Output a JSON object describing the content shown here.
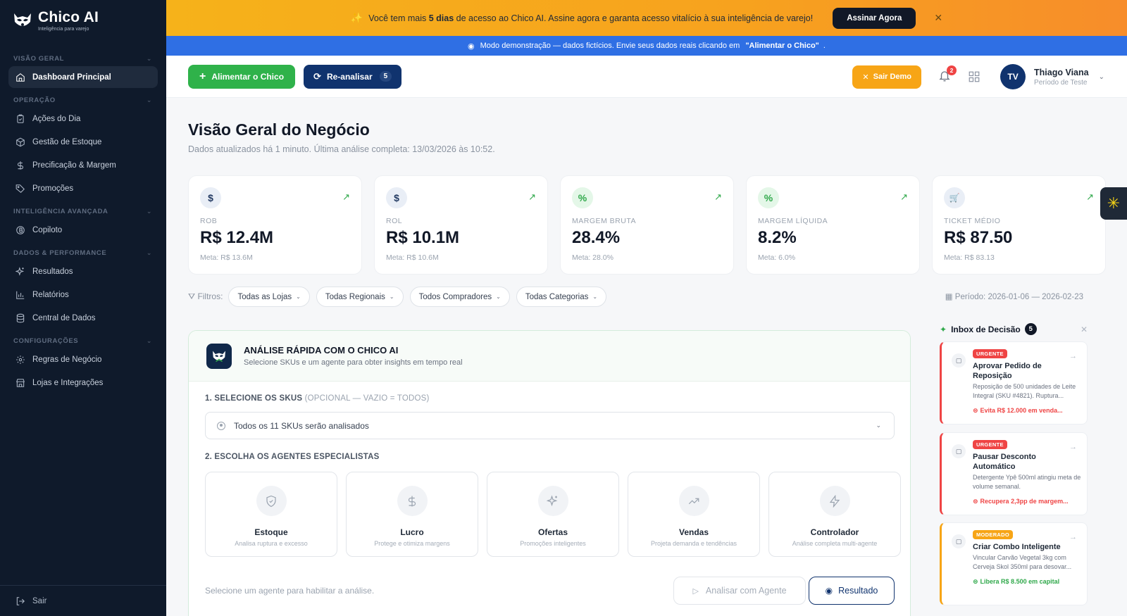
{
  "brand": {
    "name": "Chico AI",
    "tagline": "Inteligência para varejo"
  },
  "sidebar": {
    "sections": [
      {
        "title": "VISÃO GERAL",
        "items": [
          {
            "label": "Dashboard Principal",
            "icon": "home-icon",
            "active": true
          }
        ]
      },
      {
        "title": "OPERAÇÃO",
        "items": [
          {
            "label": "Ações do Dia",
            "icon": "clipboard-icon"
          },
          {
            "label": "Gestão de Estoque",
            "icon": "box-icon"
          },
          {
            "label": "Precificação & Margem",
            "icon": "dollar-icon"
          },
          {
            "label": "Promoções",
            "icon": "tag-icon"
          }
        ]
      },
      {
        "title": "INTELIGÊNCIA AVANÇADA",
        "items": [
          {
            "label": "Copiloto",
            "icon": "bitcoin-icon"
          }
        ]
      },
      {
        "title": "DADOS & PERFORMANCE",
        "items": [
          {
            "label": "Resultados",
            "icon": "sparkles-icon"
          },
          {
            "label": "Relatórios",
            "icon": "bar-chart-icon"
          },
          {
            "label": "Central de Dados",
            "icon": "database-icon"
          }
        ]
      },
      {
        "title": "CONFIGURAÇÕES",
        "items": [
          {
            "label": "Regras de Negócio",
            "icon": "gear-icon"
          },
          {
            "label": "Lojas e Integrações",
            "icon": "store-icon"
          }
        ]
      }
    ],
    "logout": "Sair"
  },
  "promo": {
    "text_before": "Você tem mais ",
    "text_bold": "5 dias",
    "text_after": " de acesso ao Chico AI. Assine agora e garanta acesso vitalício à sua inteligência de varejo!",
    "cta": "Assinar Agora"
  },
  "demo_banner": {
    "text": "Modo demonstração — dados fictícios. Envie seus dados reais clicando em",
    "highlight": "\"Alimentar o Chico\"",
    "suffix": "."
  },
  "toolbar": {
    "feed_label": "Alimentar o Chico",
    "reanalyze_label": "Re-analisar",
    "reanalyze_count": "5",
    "exit_demo": "Sair Demo",
    "notifications": "2",
    "user": {
      "initials": "TV",
      "name": "Thiago Viana",
      "role": "Período de Teste"
    }
  },
  "page": {
    "title": "Visão Geral do Negócio",
    "subtitle": "Dados atualizados há 1 minuto. Última análise completa: 13/03/2026 às 10:52."
  },
  "kpis": [
    {
      "icon_glyph": "$",
      "icon": "dollar-icon",
      "label": "ROB",
      "value": "R$ 12.4M",
      "meta": "Meta: R$ 13.6M"
    },
    {
      "icon_glyph": "$",
      "icon": "dollar-icon",
      "label": "ROL",
      "value": "R$ 10.1M",
      "meta": "Meta: R$ 10.6M"
    },
    {
      "icon_glyph": "%",
      "icon": "percent-icon",
      "label": "MARGEM BRUTA",
      "value": "28.4%",
      "meta": "Meta: 28.0%"
    },
    {
      "icon_glyph": "%",
      "icon": "percent-icon",
      "label": "MARGEM LÍQUIDA",
      "value": "8.2%",
      "meta": "Meta: 6.0%"
    },
    {
      "icon_glyph": "🛒",
      "icon": "cart-icon",
      "label": "TICKET MÉDIO",
      "value": "R$ 87.50",
      "meta": "Meta: R$ 83.13"
    }
  ],
  "filters": {
    "label": "Filtros:",
    "chips": [
      "Todas as Lojas",
      "Todas Regionais",
      "Todos Compradores",
      "Todas Categorias"
    ],
    "period": "Período: 2026-01-06 — 2026-02-23"
  },
  "analysis": {
    "title": "ANÁLISE RÁPIDA COM O CHICO AI",
    "subtitle": "Selecione SKUs e um agente para obter insights em tempo real",
    "step1": "1. SELECIONE OS SKUS",
    "step1_hint": " (OPCIONAL — VAZIO = TODOS)",
    "sku_value": "Todos os 11 SKUs serão analisados",
    "step2": "2. ESCOLHA OS AGENTES ESPECIALISTAS",
    "agents": [
      {
        "name": "Estoque",
        "desc": "Analisa ruptura e excesso",
        "icon": "shield-icon"
      },
      {
        "name": "Lucro",
        "desc": "Protege e otimiza margens",
        "icon": "dollar-icon"
      },
      {
        "name": "Ofertas",
        "desc": "Promoções inteligentes",
        "icon": "sparkles-icon"
      },
      {
        "name": "Vendas",
        "desc": "Projeta demanda e tendências",
        "icon": "trend-icon"
      },
      {
        "name": "Controlador",
        "desc": "Análise completa multi-agente",
        "icon": "bolt-icon"
      }
    ],
    "footer_hint": "Selecione um agente para habilitar a análise.",
    "analyze_btn": "Analisar com Agente",
    "result_btn": "Resultado"
  },
  "inbox": {
    "title": "Inbox de Decisão",
    "count": "5",
    "cards": [
      {
        "tag": "URGENTE",
        "title": "Aprovar Pedido de Reposição",
        "desc": "Reposição de 500 unidades de Leite Integral (SKU #4821). Ruptura...",
        "impact": "Evita R$ 12.000 em venda...",
        "tone": "urgent"
      },
      {
        "tag": "URGENTE",
        "title": "Pausar Desconto Automático",
        "desc": "Detergente Ypê 500ml atingiu meta de volume semanal.",
        "impact": "Recupera 2,3pp de margem...",
        "tone": "urgent"
      },
      {
        "tag": "MODERADO",
        "title": "Criar Combo Inteligente",
        "desc": "Vincular Carvão Vegetal 3kg com Cerveja Skol 350ml para desovar...",
        "impact": "Libera R$ 8.500 em capital",
        "tone": "moderate"
      }
    ]
  }
}
